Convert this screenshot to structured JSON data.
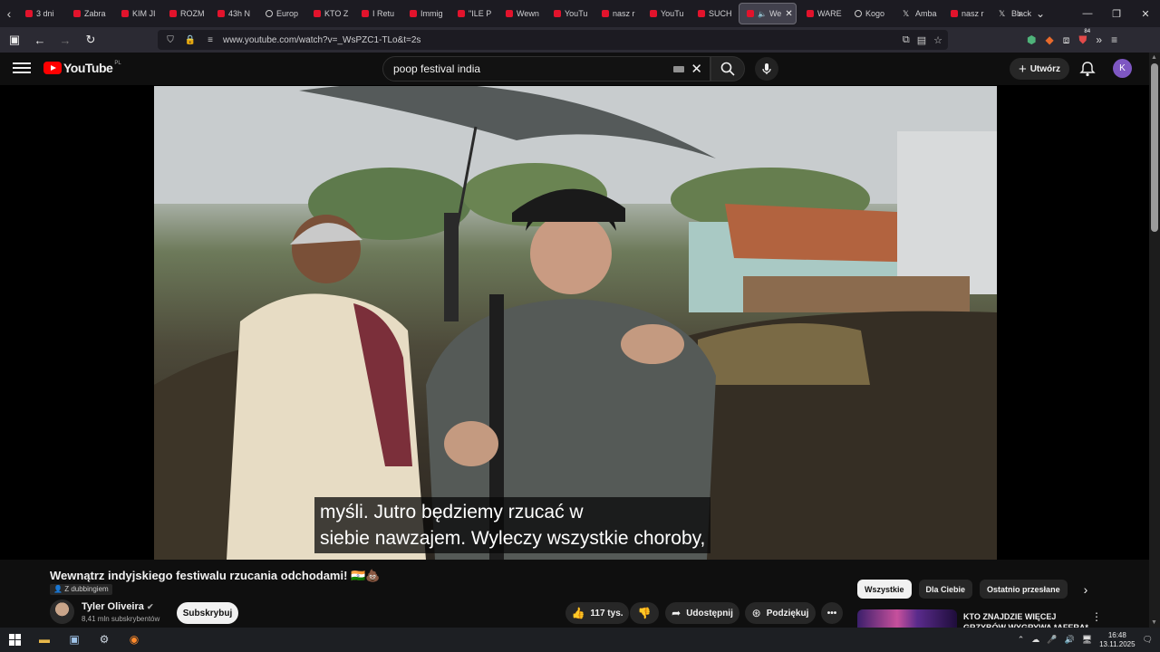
{
  "browser": {
    "tabs": [
      {
        "label": "3 dni",
        "icon": "youtube-icon"
      },
      {
        "label": "Zabra",
        "icon": "youtube-icon"
      },
      {
        "label": "KIM JI",
        "icon": "youtube-icon"
      },
      {
        "label": "ROZM",
        "icon": "youtube-icon"
      },
      {
        "label": "43h N",
        "icon": "youtube-icon"
      },
      {
        "label": "Europ",
        "icon": "globe-icon"
      },
      {
        "label": "KTO Z",
        "icon": "youtube-icon"
      },
      {
        "label": "I Retu",
        "icon": "youtube-icon"
      },
      {
        "label": "Immig",
        "icon": "youtube-icon"
      },
      {
        "label": "\"ILE P",
        "icon": "youtube-icon"
      },
      {
        "label": "Wewn",
        "icon": "youtube-icon"
      },
      {
        "label": "YouTu",
        "icon": "youtube-icon"
      },
      {
        "label": "nasz r",
        "icon": "youtube-icon"
      },
      {
        "label": "YouTu",
        "icon": "youtube-icon"
      },
      {
        "label": "SUCH",
        "icon": "youtube-icon"
      },
      {
        "label": "We",
        "icon": "youtube-icon",
        "active": true
      },
      {
        "label": "WARE",
        "icon": "youtube-icon"
      },
      {
        "label": "Kogo",
        "icon": "globe-icon"
      },
      {
        "label": "Amba",
        "icon": "x-icon"
      },
      {
        "label": "nasz r",
        "icon": "youtube-icon"
      },
      {
        "label": "Black",
        "icon": "x-icon"
      }
    ],
    "url": "www.youtube.com/watch?v=_WsPZC1-TLo&t=2s",
    "extension_badge": "84"
  },
  "youtube": {
    "logo_text": "YouTube",
    "country_code": "PL",
    "search": {
      "value": "poop festival india"
    },
    "create_label": "Utwórz",
    "avatar_letter": "K",
    "captions": [
      "myśli.  Jutro będziemy rzucać w",
      "siebie nawzajem.  Wyleczy wszystkie choroby,"
    ],
    "video": {
      "title": "Wewnątrz indyjskiego festiwalu rzucania odchodami! 🇮🇳💩",
      "dubbing_label": "Z dubbingiem",
      "channel_name": "Tyler Oliveira",
      "subscribers": "8,41 mln subskrybentów",
      "subscribe_label": "Subskrybuj",
      "likes": "117 tys.",
      "share_label": "Udostępnij",
      "thanks_label": "Podziękuj"
    },
    "chips": [
      "Wszystkie",
      "Dla Ciebie",
      "Ostatnio przesłane"
    ],
    "recommended": {
      "title": "KTO ZNAJDZIE WIĘCEJ GRZYBÓW WYGRYWA *AFERA*"
    }
  },
  "taskbar": {
    "time": "16:48",
    "date": "13.11.2025"
  }
}
